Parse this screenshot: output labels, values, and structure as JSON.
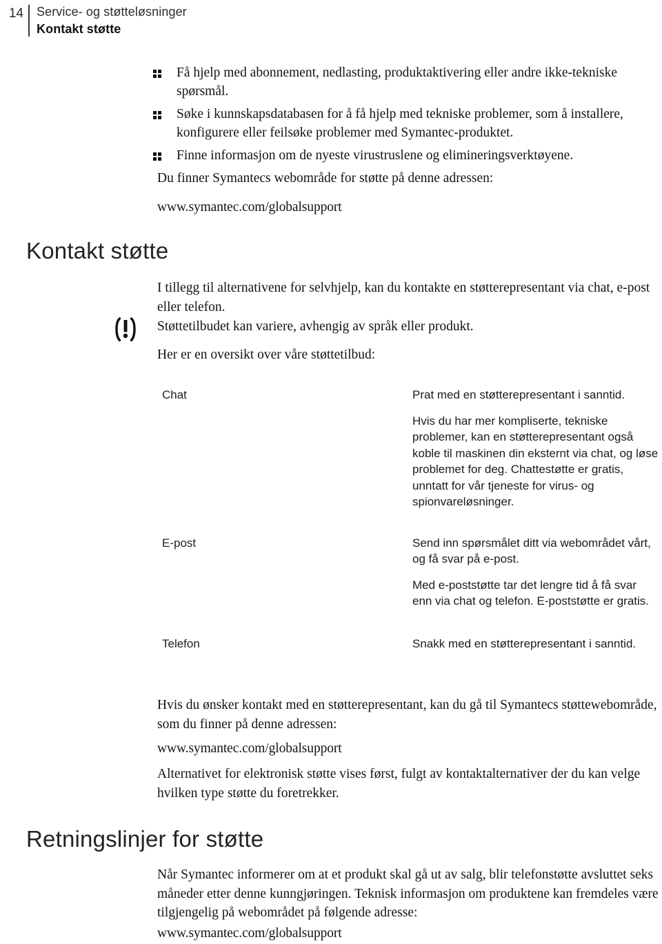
{
  "header": {
    "folio": "14",
    "chapter": "Service- og støtteløsninger",
    "section": "Kontakt støtte"
  },
  "bullets": [
    "Få hjelp med abonnement, nedlasting, produktaktivering eller andre ikke-tekniske spørsmål.",
    "Søke i kunnskapsdatabasen for å få hjelp med tekniske problemer, som å installere, konfigurere eller feilsøke problemer med Symantec-produktet.",
    "Finne informasjon om de nyeste virustruslene og elimineringsverktøyene."
  ],
  "intro": {
    "lead": "Du finner Symantecs webområde for støtte på denne adressen:",
    "url": "www.symantec.com/globalsupport"
  },
  "contact_section": {
    "heading": "Kontakt støtte",
    "paragraph_1": "I tillegg til alternativene for selvhjelp, kan du kontakte en støtterepresentant via chat, e-post eller telefon.",
    "note": "Støttetilbudet kan variere, avhengig av språk eller produkt.",
    "paragraph_2": "Her er en oversikt over våre støttetilbud:",
    "note_icon": "exclamation-note-icon"
  },
  "support_options": [
    {
      "term": "Chat",
      "paragraphs": [
        "Prat med en støtterepresentant i sanntid.",
        "Hvis du har mer kompliserte, tekniske problemer, kan en støtterepresentant også koble til maskinen din eksternt via chat, og løse problemet for deg. Chattestøtte er gratis, unntatt for vår tjeneste for virus- og spionvareløsninger."
      ]
    },
    {
      "term": "E-post",
      "paragraphs": [
        "Send inn spørsmålet ditt via webområdet vårt, og få svar på e-post.",
        "Med e-poststøtte tar det lengre tid å få svar enn via chat og telefon. E-poststøtte er gratis."
      ]
    },
    {
      "term": "Telefon",
      "paragraphs": [
        "Snakk med en støtterepresentant i sanntid."
      ]
    }
  ],
  "closing": {
    "paragraph_1": "Hvis du ønsker kontakt med en støtterepresentant, kan du gå til Symantecs støttewebområde, som du finner på denne adressen:",
    "url": "www.symantec.com/globalsupport",
    "paragraph_2": "Alternativet for elektronisk støtte vises først, fulgt av kontaktalternativer der du kan velge hvilken type støtte du foretrekker."
  },
  "guidelines_section": {
    "heading": "Retningslinjer for støtte",
    "paragraph_1": "Når Symantec informerer om at et produkt skal gå ut av salg, blir telefonstøtte avsluttet seks måneder etter denne kunngjøringen. Teknisk informasjon om produktene kan fremdeles være tilgjengelig på webområdet på følgende adresse:",
    "url": "www.symantec.com/globalsupport"
  },
  "colors": {
    "text": "#131313",
    "heading": "#232323",
    "rule": "#3a3a3a"
  }
}
